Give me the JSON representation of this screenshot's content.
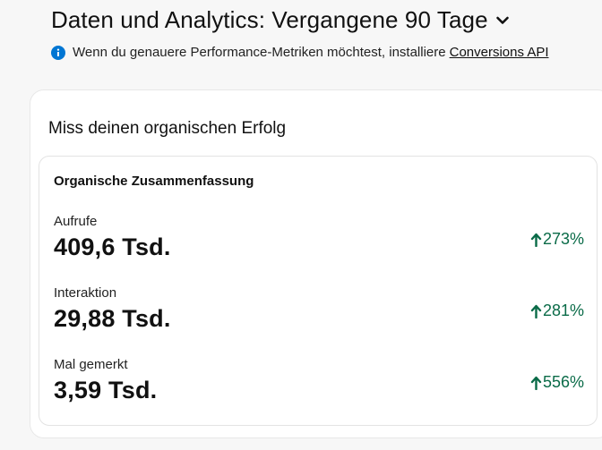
{
  "header": {
    "title": "Daten und Analytics: Vergangene 90 Tage",
    "dropdown_icon": "chevron-down-icon"
  },
  "info": {
    "icon": "info-icon",
    "text": "Wenn du genauere Performance-Metriken möchtest, installiere",
    "link_label": "Conversions API",
    "icon_color": "#0076d3"
  },
  "card": {
    "title": "Miss deinen organischen Erfolg",
    "summary": {
      "title": "Organische Zusammenfassung",
      "metrics": [
        {
          "label": "Aufrufe",
          "value": "409,6 Tsd.",
          "change": "273%",
          "icon": "arrow-up-icon"
        },
        {
          "label": "Interaktion",
          "value": "29,88 Tsd.",
          "change": "281%",
          "icon": "arrow-up-icon"
        },
        {
          "label": "Mal gemerkt",
          "value": "3,59 Tsd.",
          "change": "556%",
          "icon": "arrow-up-icon"
        }
      ]
    }
  },
  "colors": {
    "positive": "#0a6b48",
    "text": "#111111",
    "background": "#f7f7f7"
  }
}
